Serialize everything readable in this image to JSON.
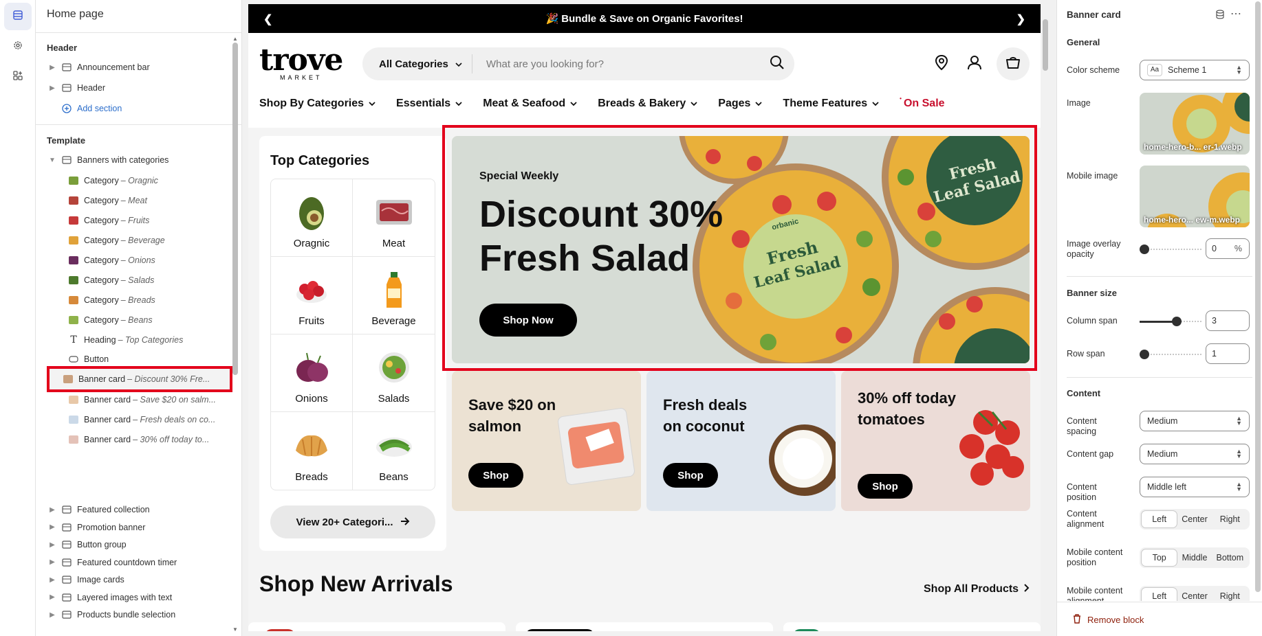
{
  "left_panel": {
    "title": "Home page",
    "header_section": "Header",
    "header_items": [
      "Announcement bar",
      "Header"
    ],
    "add_section": "Add section",
    "template_section": "Template",
    "banners_group": "Banners with categories",
    "blocks": [
      {
        "type": "Category",
        "name": "Oragnic"
      },
      {
        "type": "Category",
        "name": "Meat"
      },
      {
        "type": "Category",
        "name": "Fruits"
      },
      {
        "type": "Category",
        "name": "Beverage"
      },
      {
        "type": "Category",
        "name": "Onions"
      },
      {
        "type": "Category",
        "name": "Salads"
      },
      {
        "type": "Category",
        "name": "Breads"
      },
      {
        "type": "Category",
        "name": "Beans"
      },
      {
        "type": "Heading",
        "name": "Top Categories"
      },
      {
        "type": "Button",
        "name": ""
      },
      {
        "type": "Banner card",
        "name": "Discount 30% Fre..."
      },
      {
        "type": "Banner card",
        "name": "Save $20 on salm..."
      },
      {
        "type": "Banner card",
        "name": "Fresh deals on co..."
      },
      {
        "type": "Banner card",
        "name": "30% off today to..."
      }
    ],
    "dash": "–",
    "sections": [
      "Featured collection",
      "Promotion banner",
      "Button group",
      "Featured countdown timer",
      "Image cards",
      "Layered images with text",
      "Products bundle selection"
    ]
  },
  "preview": {
    "announcement": "🎉 Bundle & Save on Organic Favorites!",
    "logo": "trove",
    "logo_sub": "MARKET",
    "search_category": "All Categories",
    "search_placeholder": "What are you looking for?",
    "nav": [
      "Shop By Categories",
      "Essentials",
      "Meat & Seafood",
      "Breads & Bakery",
      "Pages",
      "Theme Features"
    ],
    "nav_sale": "On Sale",
    "top_categories_heading": "Top Categories",
    "categories": [
      "Oragnic",
      "Meat",
      "Fruits",
      "Beverage",
      "Onions",
      "Salads",
      "Breads",
      "Beans"
    ],
    "view_all": "View 20+ Categori...",
    "hero": {
      "kicker": "Special Weekly",
      "title": "Discount 30% Fresh Salad",
      "button": "Shop Now",
      "package_text_1": "Fresh Leaf Salad",
      "package_brand": "orbanic"
    },
    "promos": [
      {
        "title": "Save $20 on salmon",
        "button": "Shop"
      },
      {
        "title": "Fresh deals on coconut",
        "button": "Shop"
      },
      {
        "title": "30% off today tomatoes",
        "button": "Shop"
      }
    ],
    "arrivals_heading": "Shop New Arrivals",
    "all_products": "Shop All Products"
  },
  "right_panel": {
    "title": "Banner card",
    "general": "General",
    "color_scheme_label": "Color scheme",
    "color_scheme_value": "Scheme 1",
    "color_scheme_badge": "Aa",
    "image_label": "Image",
    "image_file": "home-hero-b... er-1.webp",
    "mobile_image_label": "Mobile image",
    "mobile_image_file": "home-hero... ew-m.webp",
    "overlay_label": "Image overlay opacity",
    "overlay_value": "0",
    "overlay_unit": "%",
    "banner_size": "Banner size",
    "column_span_label": "Column span",
    "column_span_value": "3",
    "column_span_fraction": 0.6,
    "row_span_label": "Row span",
    "row_span_value": "1",
    "content": "Content",
    "content_spacing_label": "Content spacing",
    "content_spacing_value": "Medium",
    "content_gap_label": "Content gap",
    "content_gap_value": "Medium",
    "content_position_label": "Content position",
    "content_position_value": "Middle left",
    "content_alignment_label": "Content alignment",
    "alignment_options": [
      "Left",
      "Center",
      "Right"
    ],
    "mobile_position_label": "Mobile content position",
    "mobile_position_options": [
      "Top",
      "Middle",
      "Bottom"
    ],
    "mobile_alignment_label": "Mobile content alignment",
    "remove_block": "Remove block"
  },
  "colors": {
    "accent_red": "#e3001b",
    "sale_red": "#c8102e",
    "hero_bg": "#d6dcd5"
  }
}
